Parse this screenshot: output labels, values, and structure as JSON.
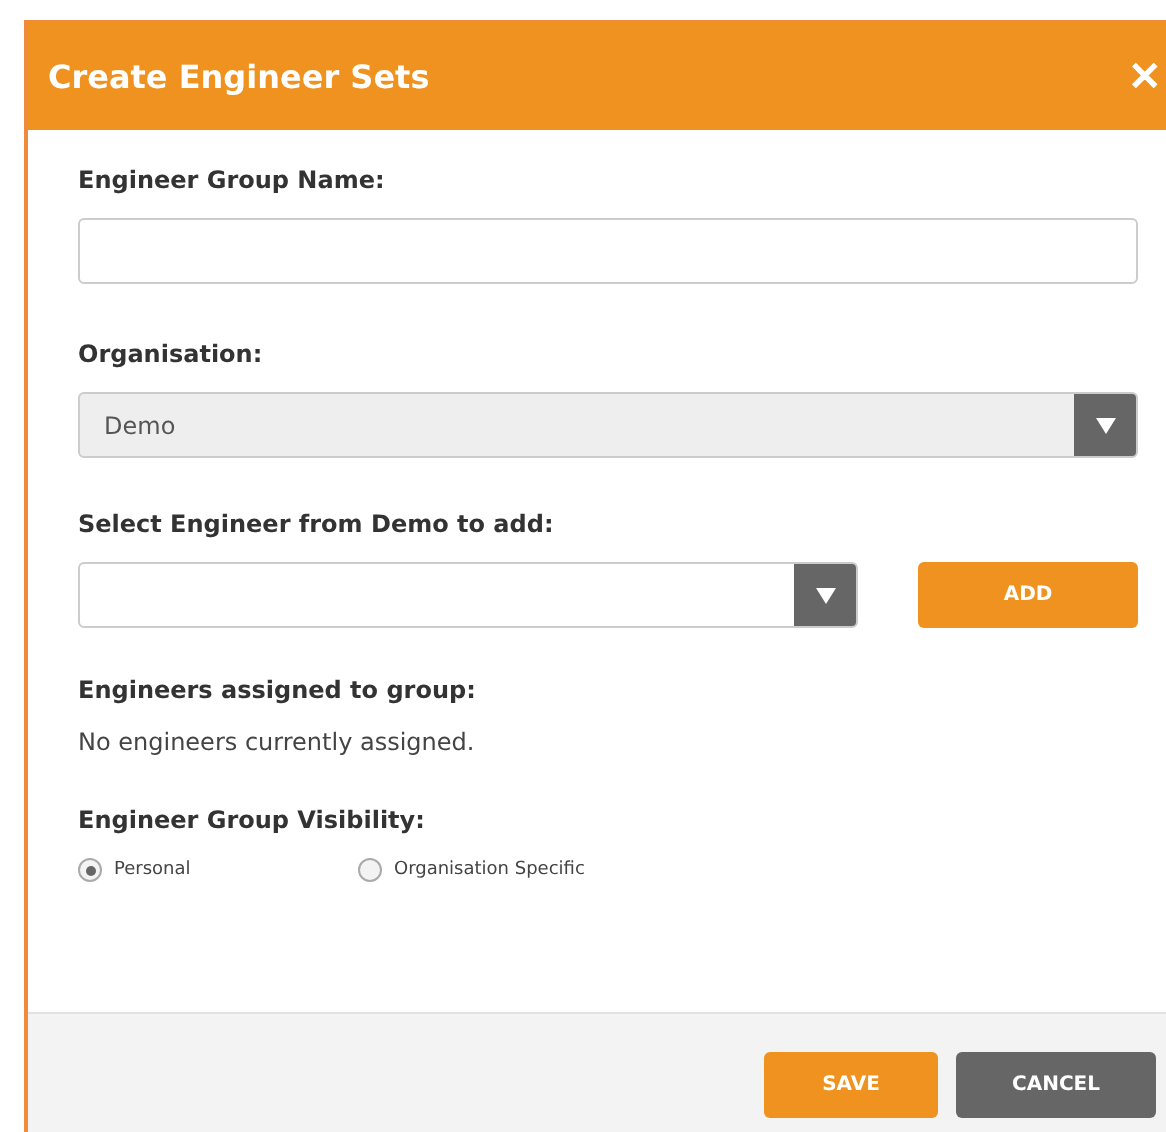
{
  "dialog": {
    "title": "Create Engineer Sets",
    "close": "✕"
  },
  "group_name": {
    "label": "Engineer Group Name:"
  },
  "organisation": {
    "label": "Organisation:",
    "value": "Demo",
    "disabled": true
  },
  "engineer_select": {
    "label": "Select Engineer from Demo to add:",
    "add_button": "ADD"
  },
  "assigned": {
    "label": "Engineers assigned to group:",
    "empty_text": "No engineers currently assigned."
  },
  "visibility": {
    "label": "Engineer Group Visibility:",
    "options": [
      {
        "label": "Personal",
        "selected": true
      },
      {
        "label": "Organisation Specific",
        "selected": false
      }
    ]
  },
  "buttons": [
    {
      "label": "SAVE",
      "kind": "primary"
    },
    {
      "label": "CANCEL",
      "kind": "secondary"
    }
  ]
}
